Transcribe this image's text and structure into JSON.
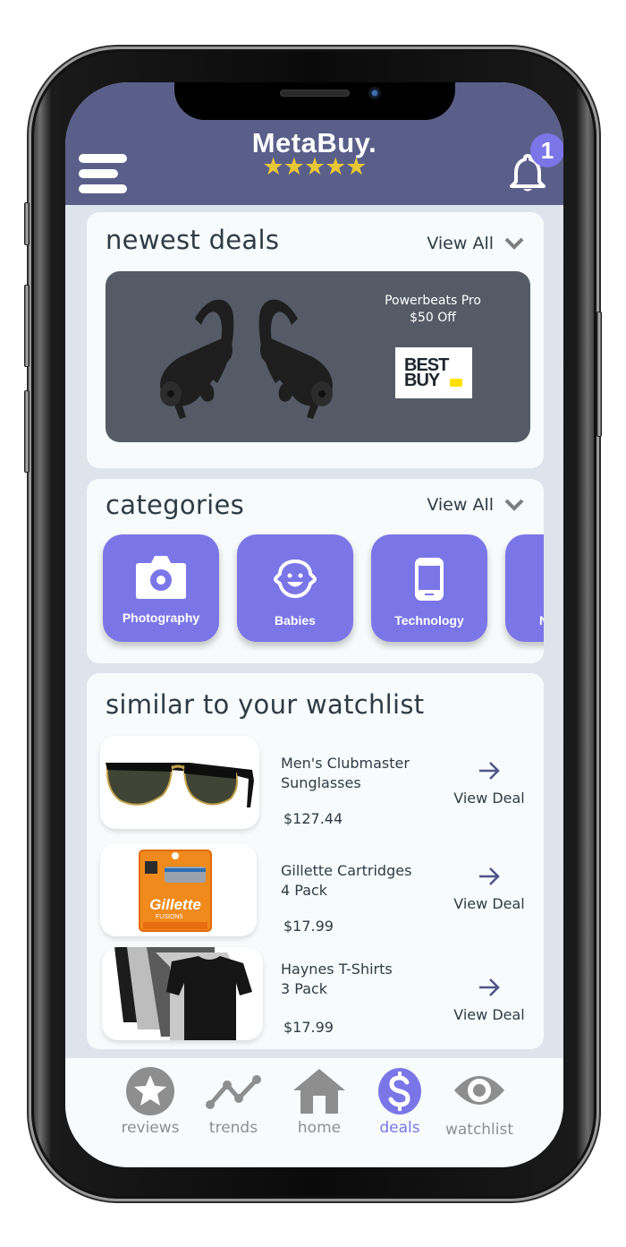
{
  "app": {
    "title": "MetaBuy.",
    "rating_stars": 5,
    "stars_text": "★★★★★",
    "notification_count": "1"
  },
  "colors": {
    "header_bg": "#5a5f8a",
    "accent": "#7b76e8",
    "star": "#e8c736",
    "card_bg": "#f7fbfb",
    "screen_bg": "#dfe3ec",
    "nav_inactive": "#8e8e8e"
  },
  "newest_deals": {
    "title": "newest deals",
    "view_all": "View All",
    "banner": {
      "product": "Powerbeats Pro",
      "offer": "$50 Off",
      "retailer_line1": "BEST",
      "retailer_line2": "BUY",
      "image": "black wireless earbuds"
    }
  },
  "categories": {
    "title": "categories",
    "view_all": "View All",
    "items": [
      {
        "label": "Photography",
        "icon": "camera-icon"
      },
      {
        "label": "Babies",
        "icon": "baby-face-icon"
      },
      {
        "label": "Technology",
        "icon": "smartphone-icon"
      },
      {
        "label": "N",
        "icon": "unknown-icon"
      }
    ]
  },
  "watchlist": {
    "title": "similar to your watchlist",
    "items": [
      {
        "name_line1": "Men's Clubmaster",
        "name_line2": "Sunglasses",
        "price": "$127.44",
        "action": "View Deal",
        "image": "sunglasses"
      },
      {
        "name_line1": "Gillette Cartridges",
        "name_line2": "4 Pack",
        "price": "$17.99",
        "action": "View Deal",
        "image": "gillette razor pack"
      },
      {
        "name_line1": "Haynes T-Shirts",
        "name_line2": "3 Pack",
        "price": "$17.99",
        "action": "View Deal",
        "image": "t-shirts"
      }
    ]
  },
  "bottom_nav": {
    "active": "deals",
    "items": [
      {
        "label": "reviews",
        "icon": "star-circle-icon"
      },
      {
        "label": "trends",
        "icon": "trend-line-icon"
      },
      {
        "label": "home",
        "icon": "home-icon"
      },
      {
        "label": "deals",
        "icon": "dollar-circle-icon"
      },
      {
        "label": "watchlist",
        "icon": "eye-icon"
      }
    ]
  }
}
